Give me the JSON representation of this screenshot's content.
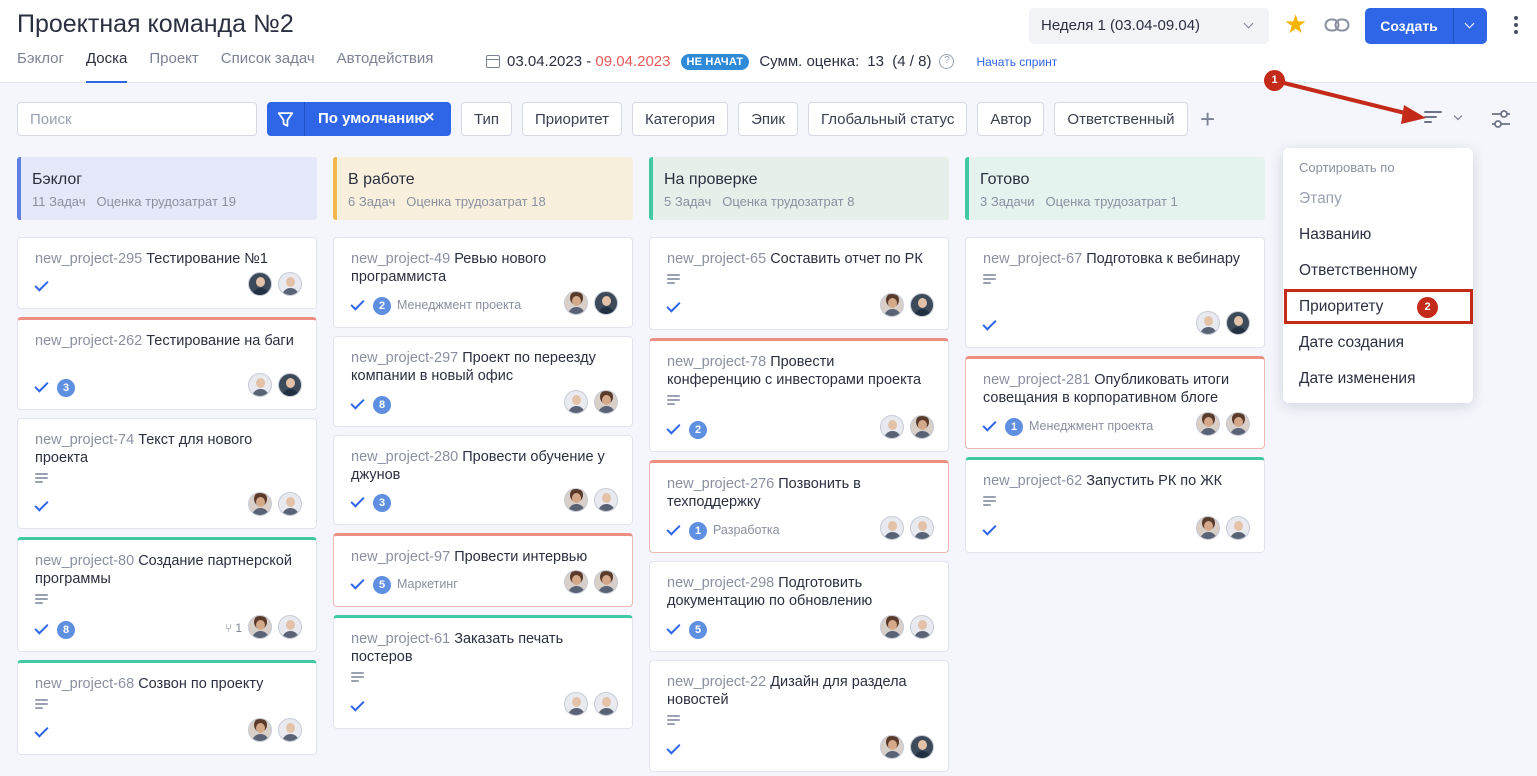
{
  "header": {
    "title": "Проектная команда №2",
    "tabs": [
      "Бэклог",
      "Доска",
      "Проект",
      "Список задач",
      "Автодействия"
    ],
    "active_tab": "Доска",
    "sprint": {
      "date_start": "03.04.2023",
      "date_sep": " - ",
      "date_end": "09.04.2023",
      "status": "НЕ НАЧАТ",
      "sum_label": "Сумм. оценка:",
      "sum_value": "13  (4 / 8)",
      "help": "?",
      "start_link": "Начать спринт"
    },
    "week_select": "Неделя 1 (03.04-09.04)",
    "create_button": "Создать"
  },
  "filters": {
    "search_placeholder": "Поиск",
    "default_filter": "По умолчанию",
    "close": "×",
    "buttons": [
      "Тип",
      "Приоритет",
      "Категория",
      "Эпик",
      "Глобальный статус",
      "Автор",
      "Ответственный"
    ],
    "plus": "+"
  },
  "annotations": [
    "1",
    "2"
  ],
  "colors": {
    "primary": "#2f66e8",
    "annotation": "#c32a1a",
    "priority_high": "#ee8f86",
    "priority_low": "#40c9a2"
  },
  "sort_menu": {
    "header": "Сортировать по",
    "items": [
      "Этапу",
      "Названию",
      "Ответственному",
      "Приоритету",
      "Дате создания",
      "Дате изменения"
    ],
    "disabled": "Этапу",
    "highlighted": "Приоритету"
  },
  "columns": [
    {
      "name": "Бэклог",
      "tasks": "11 Задач",
      "estimate": "Оценка трудозатрат 19",
      "cards": [
        {
          "id": "new_project-295",
          "title": "Тестирование №1",
          "count": "",
          "tag": "",
          "sub": ""
        },
        {
          "id": "new_project-262",
          "title": "Тестирование на баги",
          "count": "3",
          "tag": "",
          "sub": ""
        },
        {
          "id": "new_project-74",
          "title": "Текст для нового проекта",
          "count": "",
          "tag": "",
          "sub": ""
        },
        {
          "id": "new_project-80",
          "title": "Создание партнерской программы",
          "count": "8",
          "tag": "",
          "sub": "1"
        },
        {
          "id": "new_project-68",
          "title": "Созвон по проекту",
          "count": "",
          "tag": "",
          "sub": ""
        }
      ]
    },
    {
      "name": "В работе",
      "tasks": "6 Задач",
      "estimate": "Оценка трудозатрат 18",
      "cards": [
        {
          "id": "new_project-49",
          "title": "Ревью нового программиста",
          "count": "2",
          "tag": "Менеджмент проекта",
          "sub": ""
        },
        {
          "id": "new_project-297",
          "title": "Проект по переезду компании в новый офис",
          "count": "8",
          "tag": "",
          "sub": ""
        },
        {
          "id": "new_project-280",
          "title": "Провести обучение у джунов",
          "count": "3",
          "tag": "",
          "sub": ""
        },
        {
          "id": "new_project-97",
          "title": "Провести интервью",
          "count": "5",
          "tag": "Маркетинг",
          "sub": ""
        },
        {
          "id": "new_project-61",
          "title": "Заказать печать постеров",
          "count": "",
          "tag": "",
          "sub": ""
        }
      ]
    },
    {
      "name": "На проверке",
      "tasks": "5 Задач",
      "estimate": "Оценка трудозатрат 8",
      "cards": [
        {
          "id": "new_project-65",
          "title": "Составить отчет по РК",
          "count": "",
          "tag": "",
          "sub": ""
        },
        {
          "id": "new_project-78",
          "title": "Провести конференцию с инвесторами проекта",
          "count": "2",
          "tag": "",
          "sub": ""
        },
        {
          "id": "new_project-276",
          "title": "Позвонить в техподдержку",
          "count": "1",
          "tag": "Разработка",
          "sub": ""
        },
        {
          "id": "new_project-298",
          "title": "Подготовить документацию по обновлению",
          "count": "5",
          "tag": "",
          "sub": ""
        },
        {
          "id": "new_project-22",
          "title": "Дизайн для раздела новостей",
          "count": "",
          "tag": "",
          "sub": ""
        }
      ]
    },
    {
      "name": "Готово",
      "tasks": "3 Задачи",
      "estimate": "Оценка трудозатрат 1",
      "cards": [
        {
          "id": "new_project-67",
          "title": "Подготовка к вебинару",
          "count": "",
          "tag": "",
          "sub": ""
        },
        {
          "id": "new_project-281",
          "title": "Опубликовать итоги совещания в корпоративном блоге",
          "count": "1",
          "tag": "Менеджмент проекта",
          "sub": ""
        },
        {
          "id": "new_project-62",
          "title": "Запустить РК по ЖК",
          "count": "",
          "tag": "",
          "sub": ""
        }
      ]
    }
  ]
}
